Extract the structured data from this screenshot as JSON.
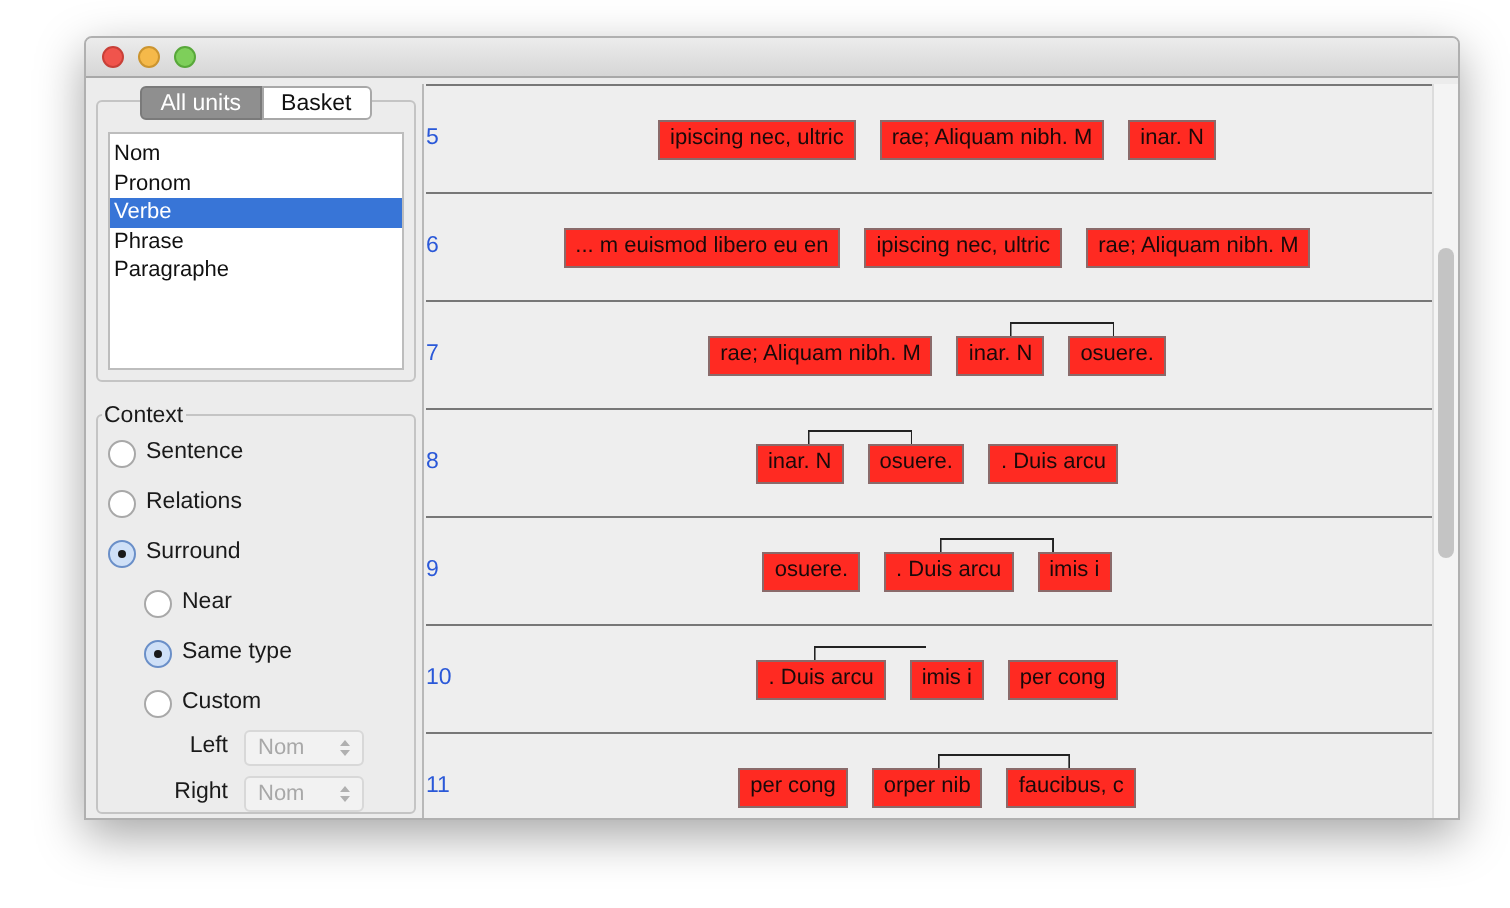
{
  "tabs": [
    {
      "label": "All units",
      "selected": true
    },
    {
      "label": "Basket",
      "selected": false
    }
  ],
  "units": [
    {
      "label": "Nom",
      "selected": false
    },
    {
      "label": "Pronom",
      "selected": false
    },
    {
      "label": "Verbe",
      "selected": true
    },
    {
      "label": "Phrase",
      "selected": false
    },
    {
      "label": "Paragraphe",
      "selected": false
    }
  ],
  "context": {
    "title": "Context",
    "options": [
      {
        "label": "Sentence",
        "selected": false
      },
      {
        "label": "Relations",
        "selected": false
      },
      {
        "label": "Surround",
        "selected": true,
        "children": [
          {
            "label": "Near",
            "selected": false
          },
          {
            "label": "Same type",
            "selected": true
          },
          {
            "label": "Custom",
            "selected": false
          }
        ]
      }
    ],
    "selects": [
      {
        "label": "Left",
        "value": "Nom",
        "disabled": true
      },
      {
        "label": "Right",
        "value": "Nom",
        "disabled": true
      }
    ]
  },
  "rows": [
    {
      "number": "5",
      "units": [
        {
          "text": "ipiscing nec, ultric",
          "linked": false
        },
        {
          "text": "rae; Aliquam nibh. M",
          "linked": false
        },
        {
          "text": "inar. N",
          "linked": false
        }
      ]
    },
    {
      "number": "6",
      "units": [
        {
          "text": "... m euismod libero eu en",
          "linked": false
        },
        {
          "text": "ipiscing nec, ultric",
          "linked": false
        },
        {
          "text": "rae; Aliquam nibh. M",
          "linked": false
        }
      ]
    },
    {
      "number": "7",
      "units": [
        {
          "text": "rae; Aliquam nibh. M",
          "linked": false
        },
        {
          "text": "inar. N",
          "linked": true
        },
        {
          "text": "osuere.",
          "linked": false
        }
      ]
    },
    {
      "number": "8",
      "units": [
        {
          "text": "inar. N",
          "linked": true
        },
        {
          "text": "osuere.",
          "linked": false
        },
        {
          "text": ". Duis arcu",
          "linked": false
        }
      ]
    },
    {
      "number": "9",
      "units": [
        {
          "text": "osuere.",
          "linked": false
        },
        {
          "text": ". Duis arcu",
          "linked": true
        },
        {
          "text": "imis i",
          "linked": false
        }
      ]
    },
    {
      "number": "10",
      "units": [
        {
          "text": ". Duis arcu",
          "linked": true
        },
        {
          "text": "imis i",
          "linked": false
        },
        {
          "text": "per cong",
          "linked": false
        }
      ]
    },
    {
      "number": "11",
      "units": [
        {
          "text": "per cong",
          "linked": false
        },
        {
          "text": "orper nib",
          "linked": true
        },
        {
          "text": "faucibus, c",
          "linked": false
        }
      ]
    }
  ]
}
